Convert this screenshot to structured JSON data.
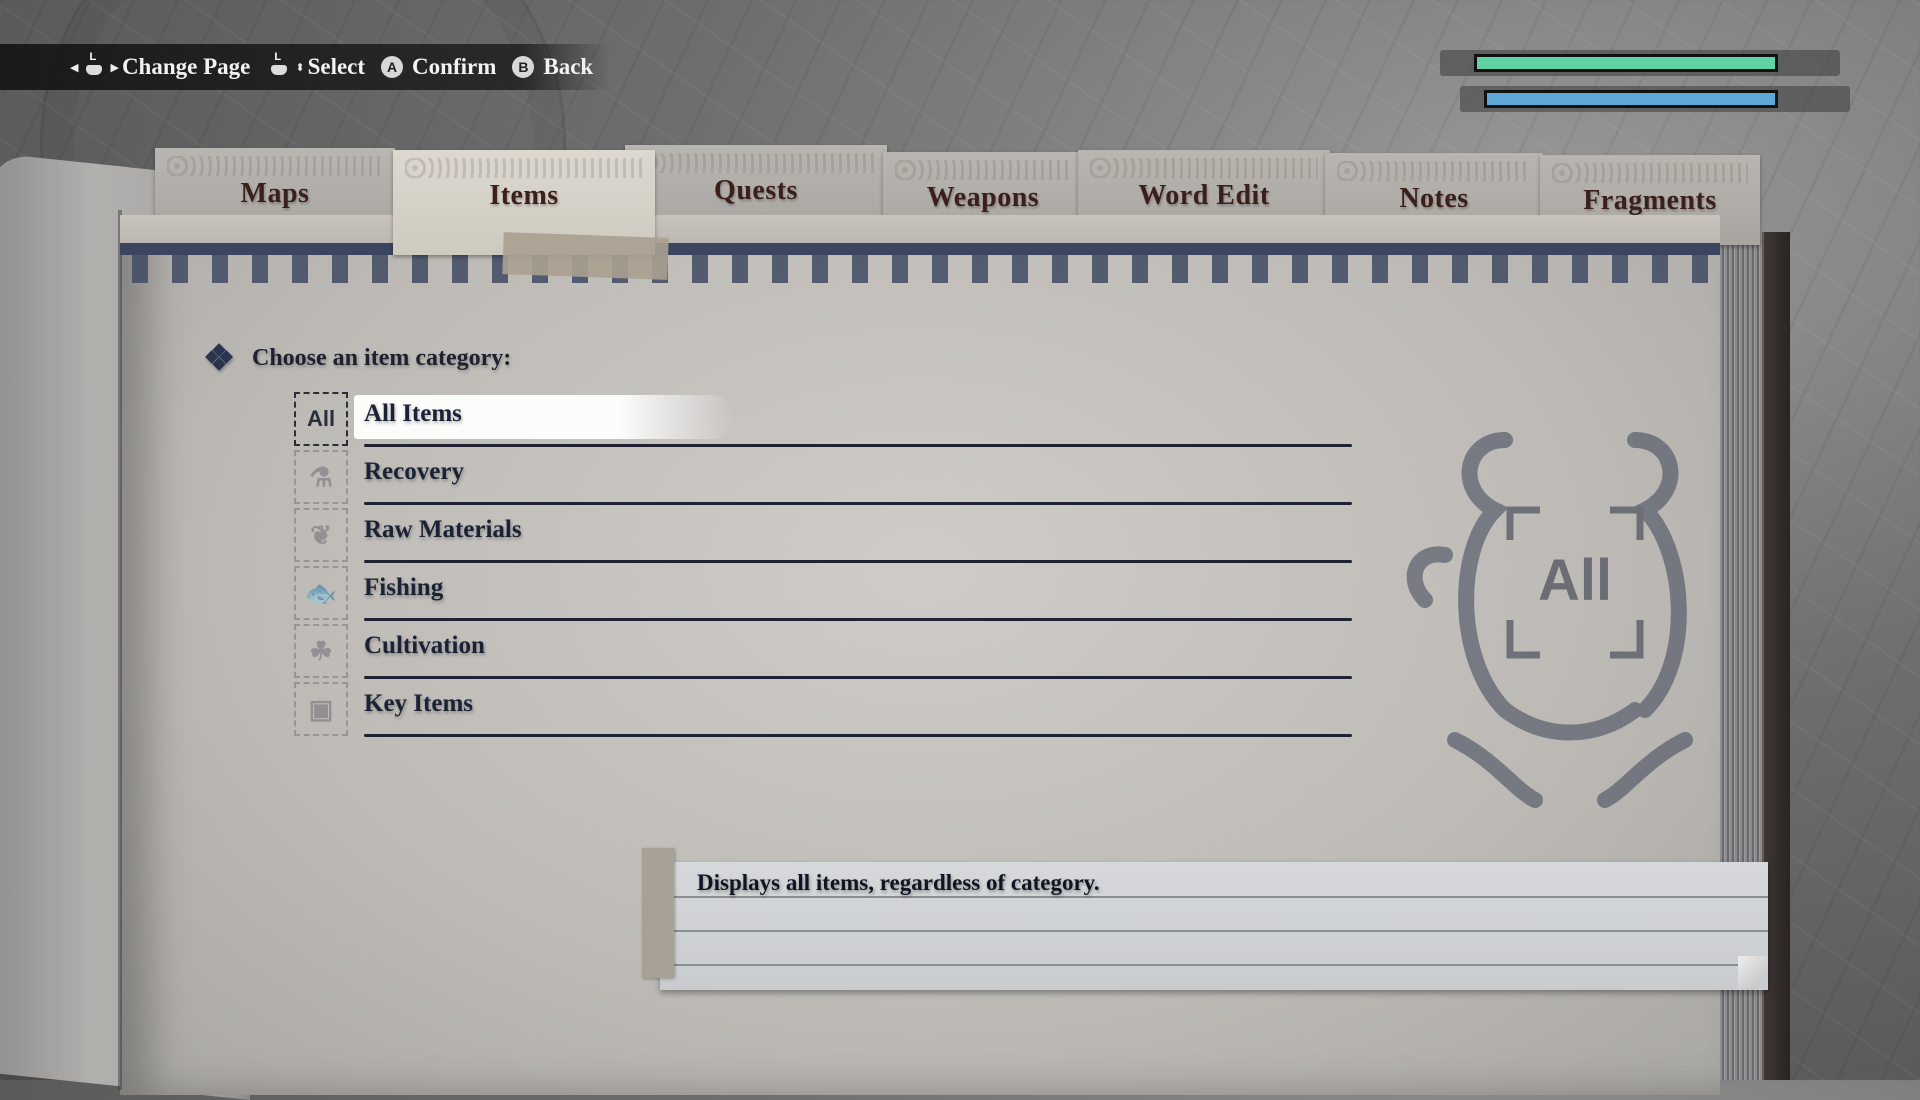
{
  "hints": [
    {
      "control": "left-stick-horizontal",
      "label": "Change Page"
    },
    {
      "control": "left-stick-vertical",
      "label": "Select"
    },
    {
      "control": "A",
      "label": "Confirm"
    },
    {
      "control": "B",
      "label": "Back"
    }
  ],
  "gauges": [
    {
      "name": "health",
      "fill": 1.0,
      "color": "#5fd3a3"
    },
    {
      "name": "mana",
      "fill": 1.0,
      "color": "#5fa8d6"
    }
  ],
  "tabs": [
    {
      "label": "Maps",
      "active": false
    },
    {
      "label": "Items",
      "active": true
    },
    {
      "label": "Quests",
      "active": false
    },
    {
      "label": "Weapons",
      "active": false
    },
    {
      "label": "Word Edit",
      "active": false
    },
    {
      "label": "Notes",
      "active": false
    },
    {
      "label": "Fragments",
      "active": false
    }
  ],
  "prompt": "Choose an item category:",
  "categories": [
    {
      "label": "All Items",
      "icon": "all-icon",
      "icon_text": "All",
      "selected": true
    },
    {
      "label": "Recovery",
      "icon": "potion-bottle-icon",
      "icon_text": "⚗",
      "selected": false
    },
    {
      "label": "Raw Materials",
      "icon": "leaf-icon",
      "icon_text": "❦",
      "selected": false
    },
    {
      "label": "Fishing",
      "icon": "fish-icon",
      "icon_text": "🐟",
      "selected": false
    },
    {
      "label": "Cultivation",
      "icon": "sprout-icon",
      "icon_text": "☘",
      "selected": false
    },
    {
      "label": "Key Items",
      "icon": "treasure-chest-icon",
      "icon_text": "▣",
      "selected": false
    }
  ],
  "emblem": {
    "text": "All"
  },
  "description": "Displays all items, regardless of category.",
  "colors": {
    "ink": "#1b2236",
    "band": "#3f4a62",
    "tab_text": "#3a1f1a"
  }
}
